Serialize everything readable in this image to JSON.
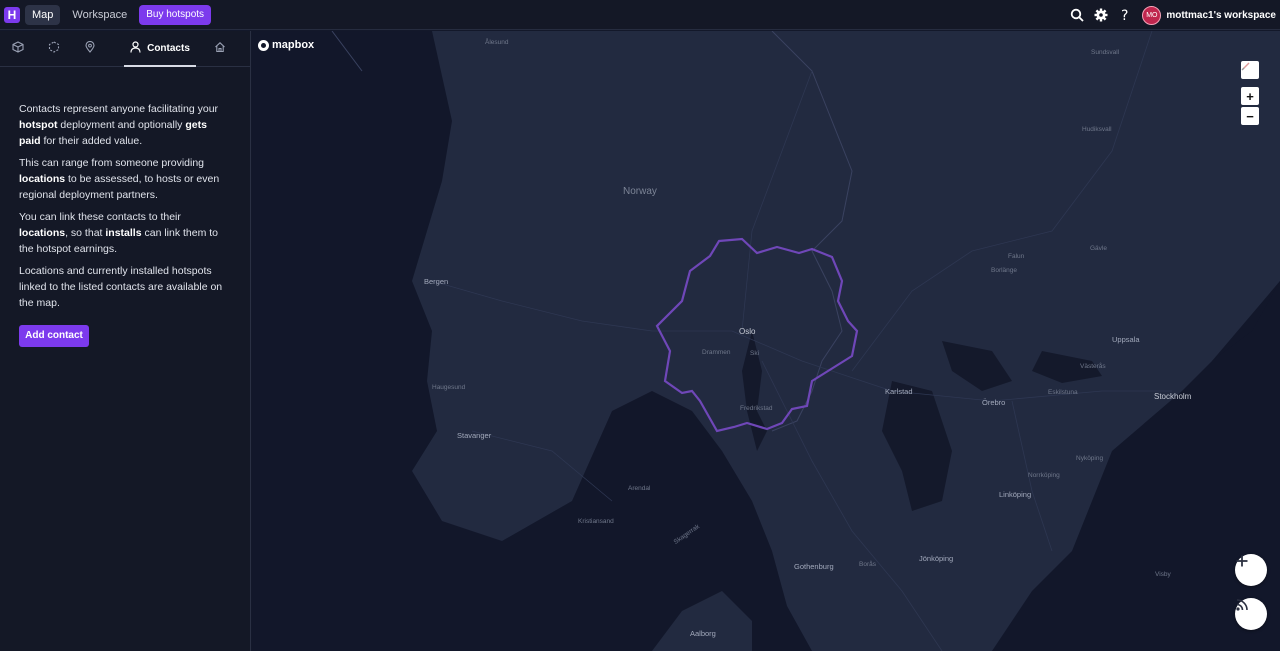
{
  "app": {
    "logo_letter": "H",
    "nav": {
      "map": "Map",
      "workspace": "Workspace",
      "buy": "Buy hotspots"
    },
    "user": {
      "initials": "MO",
      "workspace_name": "mottmac1's workspace"
    },
    "colors": {
      "accent": "#7c3aed",
      "avatar": "#c0264e"
    }
  },
  "sidebar": {
    "tabs": [
      {
        "icon": "cube-icon"
      },
      {
        "icon": "hex-dashed-icon"
      },
      {
        "icon": "location-pin-icon"
      },
      {
        "icon": "person-icon",
        "label": "Contacts",
        "active": true
      },
      {
        "icon": "home-icon"
      }
    ],
    "intro": {
      "p1_a": "Contacts represent anyone facilitating your ",
      "p1_b": "hotspot",
      "p1_c": " deployment and optionally ",
      "p1_d": "gets paid",
      "p1_e": " for their added value.",
      "p2_a": "This can range from someone providing ",
      "p2_b": "locations",
      "p2_c": " to be assessed, to hosts or even regional deployment partners.",
      "p3_a": "You can link these contacts to their ",
      "p3_b": "locations",
      "p3_c": ", so that ",
      "p3_d": "installs",
      "p3_e": " can link them to the hotspot earnings.",
      "p4": "Locations and currently installed hotspots linked to the listed contacts are available on the map."
    },
    "add_button": "Add contact"
  },
  "map": {
    "brand": "mapbox",
    "labels": {
      "norway": "Norway",
      "alesund": "Ålesund",
      "sundsvall": "Sundsvall",
      "hudiksvall": "Hudiksvall",
      "bergen": "Bergen",
      "oslo": "Oslo",
      "drammen": "Drammen",
      "ski": "Ski",
      "fredrikstad": "Fredrikstad",
      "haugesund": "Haugesund",
      "stavanger": "Stavanger",
      "arendal": "Arendal",
      "kristiansand": "Kristiansand",
      "skagerrak": "Skagerrak",
      "falun": "Falun",
      "borlange": "Borlänge",
      "gavle": "Gävle",
      "uppsala": "Uppsala",
      "vasteras": "Västerås",
      "eskilstuna": "Eskilstuna",
      "stockholm": "Stockholm",
      "orebro": "Örebro",
      "karlstad": "Karlstad",
      "nykoping": "Nyköping",
      "norrkoping": "Norrköping",
      "linkoping": "Linköping",
      "jonkoping": "Jönköping",
      "gothenburg": "Gothenburg",
      "boras": "Borås",
      "visby": "Visby",
      "aalborg": "Aalborg"
    },
    "controls": {
      "zoom_in": "+",
      "zoom_out": "−"
    },
    "region_color": "#6f47b8"
  }
}
